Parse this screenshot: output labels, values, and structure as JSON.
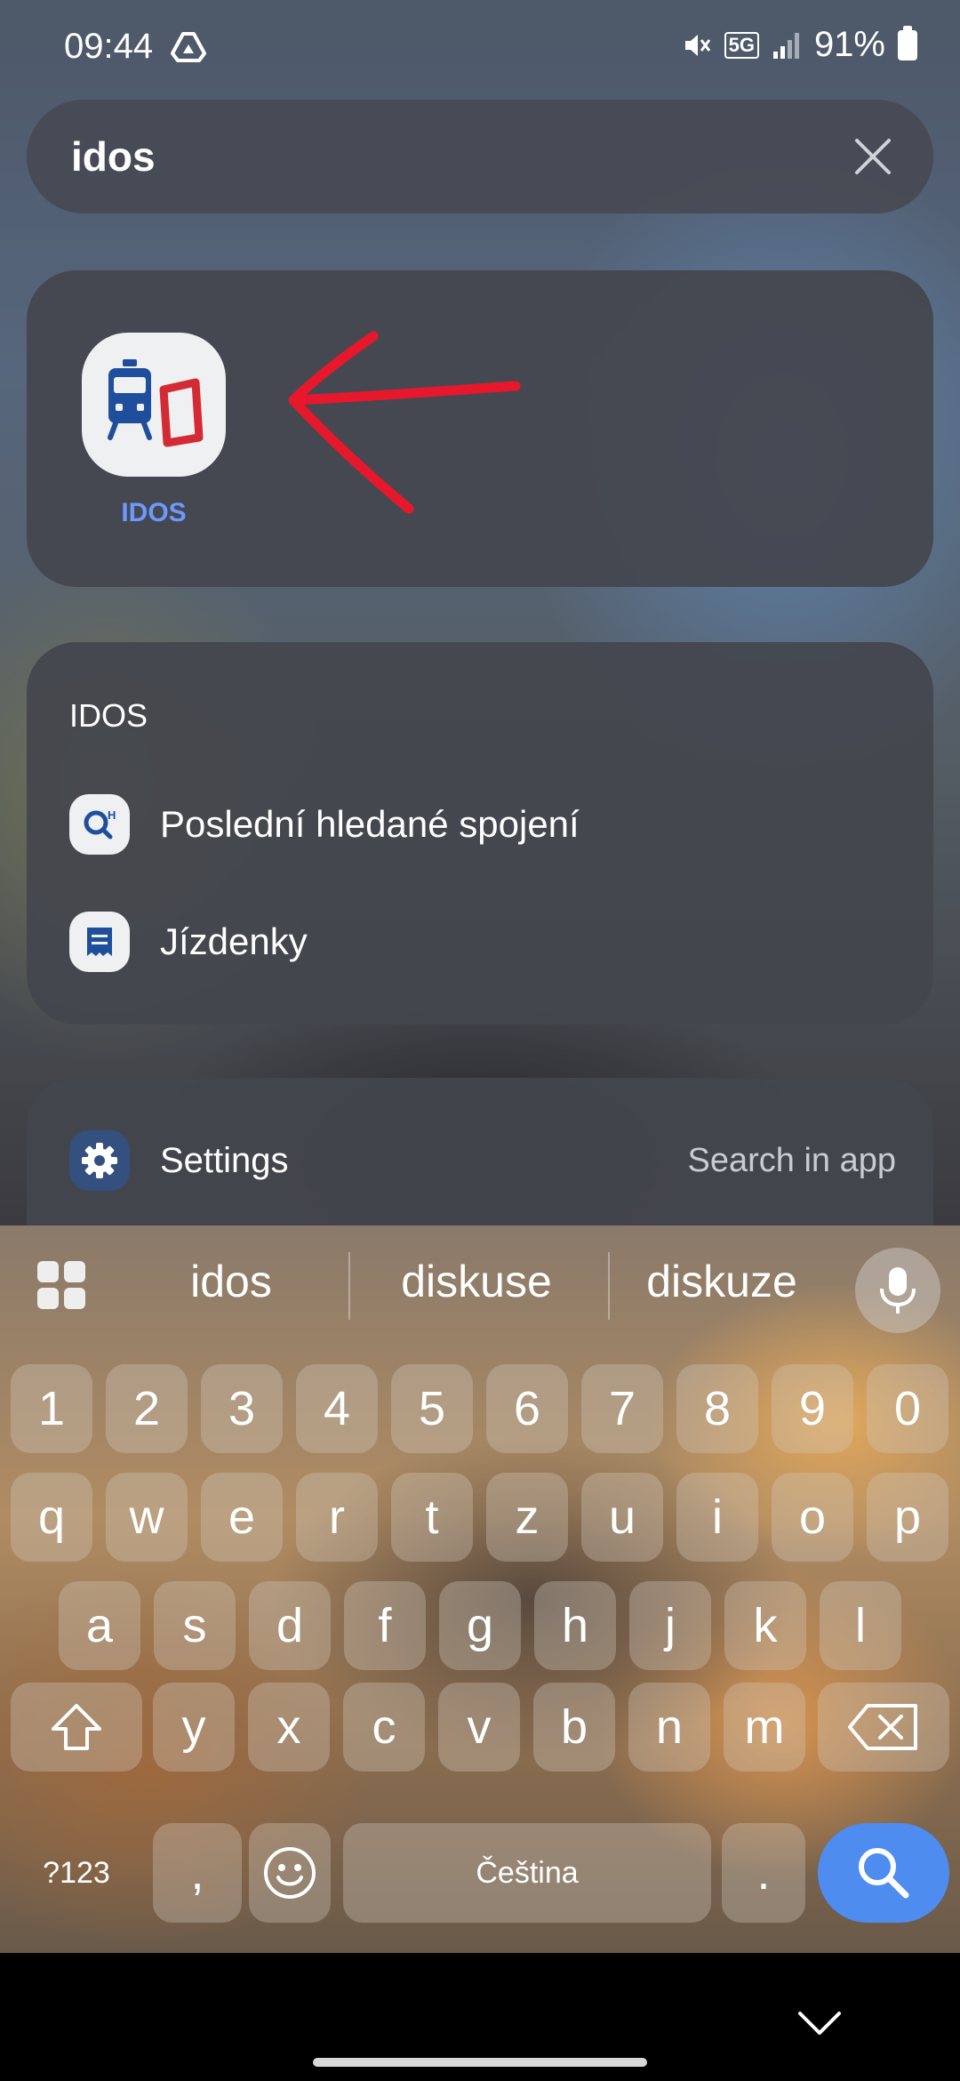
{
  "status_bar": {
    "time": "09:44",
    "battery": "91%",
    "network": "5G",
    "icons": [
      "google-drive-icon",
      "mute-icon",
      "5g-icon",
      "signal-icon",
      "battery-icon"
    ]
  },
  "search": {
    "query": "idos",
    "clear_icon": "close-icon"
  },
  "app_result": {
    "label": "IDOS",
    "icon": "train-ticket-icon",
    "annotation": "red-arrow"
  },
  "app_actions": {
    "title": "IDOS",
    "items": [
      {
        "label": "Poslední hledané spojení",
        "icon": "search-history-icon"
      },
      {
        "label": "Jízdenky",
        "icon": "ticket-receipt-icon"
      }
    ]
  },
  "settings_result": {
    "label": "Settings",
    "action": "Search in app",
    "icon": "gear-icon"
  },
  "keyboard": {
    "suggestions": [
      "idos",
      "diskuse",
      "diskuze"
    ],
    "row_numbers": [
      "1",
      "2",
      "3",
      "4",
      "5",
      "6",
      "7",
      "8",
      "9",
      "0"
    ],
    "row_top": [
      "q",
      "w",
      "e",
      "r",
      "t",
      "z",
      "u",
      "i",
      "o",
      "p"
    ],
    "row_middle": [
      "a",
      "s",
      "d",
      "f",
      "g",
      "h",
      "j",
      "k",
      "l"
    ],
    "row_bottom": [
      "y",
      "x",
      "c",
      "v",
      "b",
      "n",
      "m"
    ],
    "symbols_label": "?123",
    "comma": ",",
    "space_label": "Čeština",
    "period": "."
  },
  "colors": {
    "accent": "#4e8cf0",
    "app_label": "#6d99ff",
    "arrow": "#e8182c"
  }
}
